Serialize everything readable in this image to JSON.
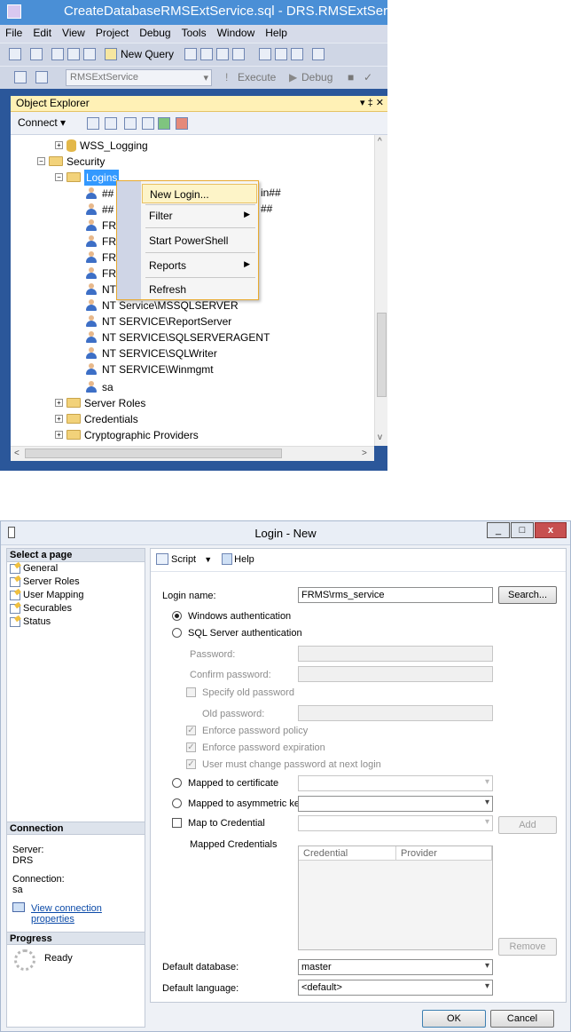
{
  "ssms": {
    "window_title": "CreateDatabaseRMSExtService.sql - DRS.RMSExtService",
    "menu": [
      "File",
      "Edit",
      "View",
      "Project",
      "Debug",
      "Tools",
      "Window",
      "Help"
    ],
    "toolbar": {
      "new_query": "New Query",
      "database": "RMSExtService",
      "execute": "Execute",
      "debug": "Debug"
    },
    "object_explorer": {
      "title": "Object Explorer",
      "pin_label": "▾ ‡ ✕",
      "connect_label": "Connect ▾",
      "tree": {
        "wss_logging": "WSS_Logging",
        "security": "Security",
        "logins": "Logins",
        "hidden_rows": [
          "##",
          "##",
          "FR",
          "FR",
          "FR",
          "FR",
          "NT"
        ],
        "hidden_suffix_1": "in##",
        "hidden_suffix_2": "##",
        "logins_visible": [
          "NT Service\\MSSQLSERVER",
          "NT SERVICE\\ReportServer",
          "NT SERVICE\\SQLSERVERAGENT",
          "NT SERVICE\\SQLWriter",
          "NT SERVICE\\Winmgmt",
          "sa"
        ],
        "server_roles": "Server Roles",
        "credentials": "Credentials",
        "crypto": "Cryptographic Providers"
      }
    },
    "context_menu": {
      "new_login": "New Login...",
      "filter": "Filter",
      "start_powershell": "Start PowerShell",
      "reports": "Reports",
      "refresh": "Refresh"
    }
  },
  "dialog": {
    "title": "Login - New",
    "select_page": "Select a page",
    "pages": [
      "General",
      "Server Roles",
      "User Mapping",
      "Securables",
      "Status"
    ],
    "connection": {
      "header": "Connection",
      "server_label": "Server:",
      "server_value": "DRS",
      "connection_label": "Connection:",
      "connection_value": "sa",
      "view_props": "View connection properties"
    },
    "progress": {
      "header": "Progress",
      "status": "Ready"
    },
    "toolbar": {
      "script": "Script",
      "help": "Help"
    },
    "form": {
      "login_name_label": "Login name:",
      "login_name_value": "FRMS\\rms_service",
      "search_button": "Search...",
      "windows_auth": "Windows authentication",
      "sql_auth": "SQL Server authentication",
      "password": "Password:",
      "confirm_password": "Confirm password:",
      "specify_old": "Specify old password",
      "old_password": "Old password:",
      "enforce_policy": "Enforce password policy",
      "enforce_expiration": "Enforce password expiration",
      "must_change": "User must change password at next login",
      "mapped_cert": "Mapped to certificate",
      "mapped_asym": "Mapped to asymmetric key",
      "map_credential": "Map to Credential",
      "add_button": "Add",
      "mapped_credentials": "Mapped Credentials",
      "cred_col": "Credential",
      "provider_col": "Provider",
      "remove_button": "Remove",
      "default_db_label": "Default database:",
      "default_db_value": "master",
      "default_lang_label": "Default language:",
      "default_lang_value": "<default>"
    },
    "buttons": {
      "ok": "OK",
      "cancel": "Cancel"
    },
    "window_buttons": {
      "minimize": "_",
      "maximize": "□",
      "close": "x"
    }
  }
}
